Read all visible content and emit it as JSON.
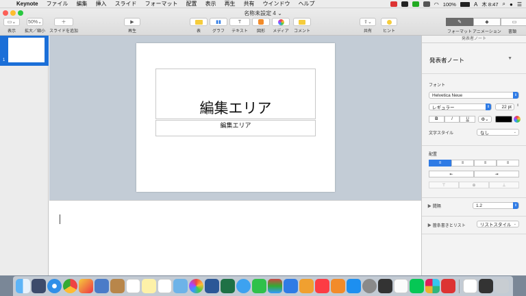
{
  "menubar": {
    "apple": "",
    "items": [
      "Keynote",
      "ファイル",
      "編集",
      "挿入",
      "スライド",
      "フォーマット",
      "配置",
      "表示",
      "再生",
      "共有",
      "ウインドウ",
      "ヘルプ"
    ],
    "battery": "100%",
    "clock": "木 8:47"
  },
  "window": {
    "title": "名称未設定 4"
  },
  "toolbar": {
    "view": "表示",
    "zoom_value": "50%",
    "zoom_label": "拡大／縮小",
    "add_slide": "スライドを追加",
    "play": "再生",
    "table": "表",
    "chart": "グラフ",
    "text": "テキスト",
    "shape": "図形",
    "media": "メディア",
    "comment": "コメント",
    "share": "共有",
    "tips": "ヒント",
    "format_tab": "フォーマット",
    "animation_tab": "アニメーション",
    "document_tab": "書類"
  },
  "navigator": {
    "slide_number": "1"
  },
  "slide": {
    "title": "編集エリア",
    "body": "編集エリア"
  },
  "inspector": {
    "header": "発表者ノート",
    "section_title": "発表者ノート",
    "font_label": "フォント",
    "font_name": "Helvetica Neue",
    "font_style": "レギュラー",
    "font_size": "22 pt",
    "bold": "B",
    "italic": "I",
    "underline": "U",
    "char_style_label": "文字スタイル",
    "char_style_value": "なし",
    "align_label": "配置",
    "spacing_label": "間隔",
    "spacing_value": "1.2",
    "bullets_label": "箇条書きとリスト",
    "bullets_value": "リストスタイル"
  },
  "colors": {
    "accent": "#2f7be5",
    "selection": "#1b6fd8",
    "canvas": "#c3ccd6"
  }
}
